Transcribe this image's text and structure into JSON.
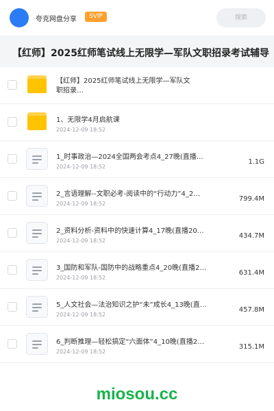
{
  "header": {
    "username": "夸克网盘分享",
    "badge": "SVIP",
    "search_placeholder": "搜索",
    "avatar_color": "#2c7cf6"
  },
  "page_title": "【红师】2025红师笔试线上无限学—军队文职招录考试辅导",
  "files": [
    {
      "type": "folder",
      "name": "【红师】2025红师笔试线上无限学—军队文职招录…",
      "date": "",
      "size": ""
    },
    {
      "type": "folder",
      "name": "1、无限学4月启航课",
      "date": "2024-12-09 18:52",
      "size": ""
    },
    {
      "type": "doc",
      "name": "1_时事政治—2024全国两会考点4_27晚(直播…",
      "date": "2024-12-09 18:52",
      "size": "1.1G"
    },
    {
      "type": "doc",
      "name": "2_言语理解--文职必考-阅读中的“行动力”4_2…",
      "date": "2024-12-09 18:52",
      "size": "799.4M"
    },
    {
      "type": "doc",
      "name": "2_资料分析-资料中的快速计算4_17晚(直播20…",
      "date": "2024-12-09 18:52",
      "size": "434.7M"
    },
    {
      "type": "doc",
      "name": "3_国防和军队-国防中的战略重点4_20晚(直播2…",
      "date": "2024-12-09 18:52",
      "size": "631.4M"
    },
    {
      "type": "doc",
      "name": "5_人文社会—法治知识之护“未”成长4_13晚(直…",
      "date": "2024-12-09 18:52",
      "size": "457.8M"
    },
    {
      "type": "doc",
      "name": "6_判断推理—轻松搞定“六面体”4_10晚(直播2…",
      "date": "2024-12-09 18:52",
      "size": "315.1M"
    }
  ],
  "watermark": "miosou.cc"
}
